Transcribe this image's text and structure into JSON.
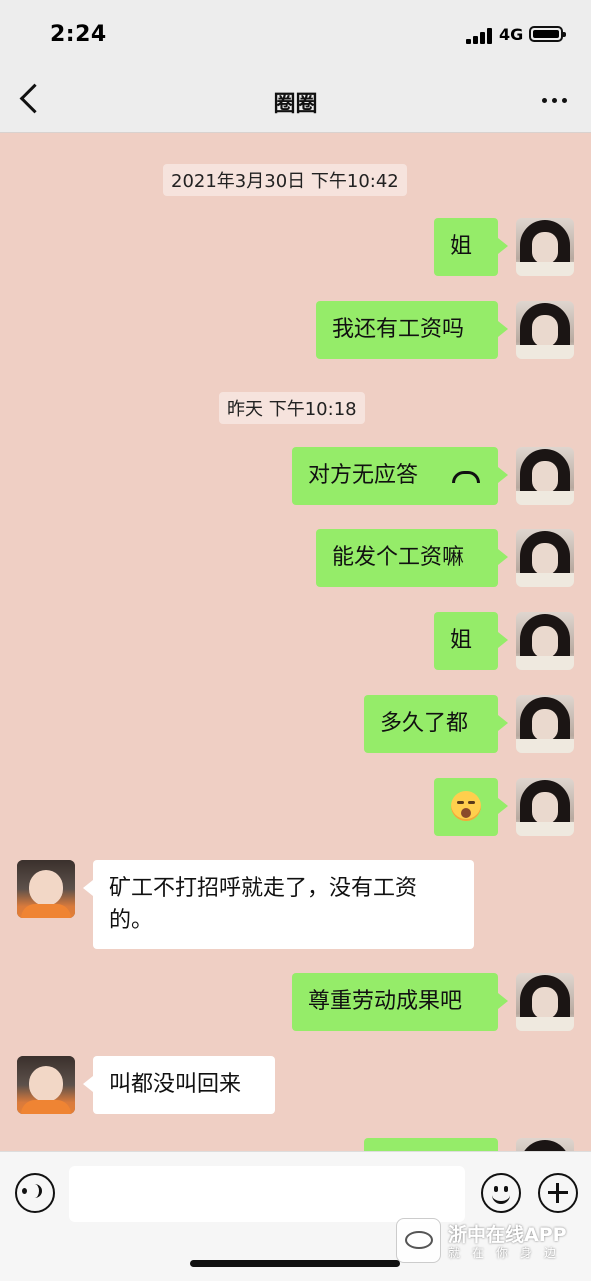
{
  "status_bar": {
    "time": "2:24",
    "network": "4G"
  },
  "header": {
    "title": "圈圈"
  },
  "timestamps": [
    "2021年3月30日 下午10:42",
    "昨天 下午10:18"
  ],
  "messages": [
    {
      "sender": "me",
      "text": "姐"
    },
    {
      "sender": "me",
      "text": "我还有工资吗"
    },
    {
      "sender": "me",
      "text": "对方无应答",
      "type": "call"
    },
    {
      "sender": "me",
      "text": "能发个工资嘛"
    },
    {
      "sender": "me",
      "text": "姐"
    },
    {
      "sender": "me",
      "text": "多久了都"
    },
    {
      "sender": "me",
      "type": "emoji",
      "icon": "sleepy-face-emoji"
    },
    {
      "sender": "other",
      "text": "矿工不打招呼就走了，没有工资的。"
    },
    {
      "sender": "me",
      "text": "尊重劳动成果吧"
    },
    {
      "sender": "other",
      "text": "叫都没叫回来"
    }
  ],
  "input_bar": {
    "text_value": ""
  },
  "watermark": {
    "title": "浙中在线APP",
    "subtitle": "就在你身边"
  },
  "colors": {
    "chat_background": "#efcfc4",
    "my_bubble": "#95ec69",
    "other_bubble": "#ffffff"
  }
}
